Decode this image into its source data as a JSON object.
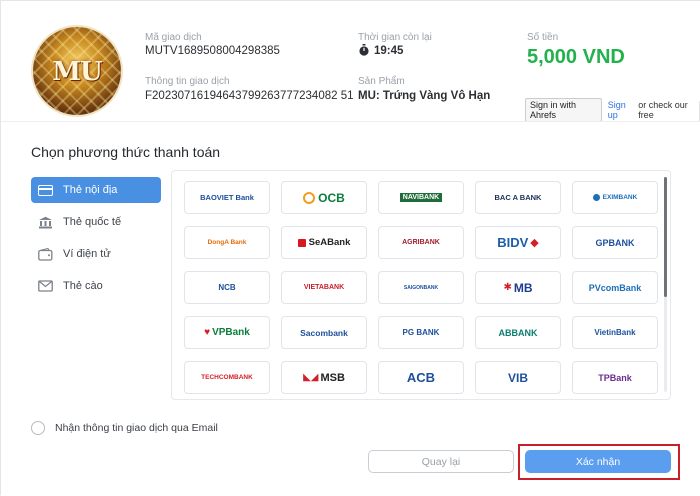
{
  "transaction": {
    "id_label": "Mã giao dịch",
    "id_value": "MUTV1689508004298385",
    "time_label": "Thời gian còn lại",
    "time_value": "19:45",
    "amount_label": "Số tiền",
    "amount_value": "5,000 VND",
    "info_label": "Thông tin giao dịch",
    "info_value": "F20230716194643799263777234082 51",
    "product_label": "Sản Phẩm",
    "product_value": "MU: Trứng Vàng Vô Hạn",
    "logo_text": "MU"
  },
  "ahrefs": {
    "signin_label": "Sign in with Ahrefs",
    "signup_label": "Sign up",
    "rest_label": "or check our free"
  },
  "panel": {
    "title": "Chọn phương thức thanh toán",
    "methods": [
      {
        "label": "Thẻ nội địa",
        "icon": "card-icon",
        "active": true
      },
      {
        "label": "Thẻ quốc tế",
        "icon": "bank-building-icon",
        "active": false
      },
      {
        "label": "Ví điện tử",
        "icon": "wallet-icon",
        "active": false
      },
      {
        "label": "Thẻ cào",
        "icon": "scratch-card-icon",
        "active": false
      }
    ],
    "banks": [
      "BAOVIET Bank",
      "OCB",
      "NAVIBANK",
      "BAC A BANK",
      "EXIMBANK",
      "DongA Bank",
      "SeABank",
      "AGRIBANK",
      "BIDV",
      "GPBANK",
      "NCB",
      "VIETABANK",
      "SAIGONBANK",
      "MB",
      "PVcomBank",
      "VPBank",
      "Sacombank",
      "PG BANK",
      "ABBANK",
      "VietinBank",
      "TECHCOMBANK",
      "MSB",
      "ACB",
      "VIB",
      "TPBank"
    ],
    "email_label": "Nhận thông tin giao dịch qua Email",
    "back_label": "Quay lại",
    "confirm_label": "Xác nhận"
  },
  "colors": {
    "accent": "#4a90e2",
    "amount": "#22b14c",
    "confirm": "#5b9ef0",
    "highlight": "#c8202a"
  }
}
